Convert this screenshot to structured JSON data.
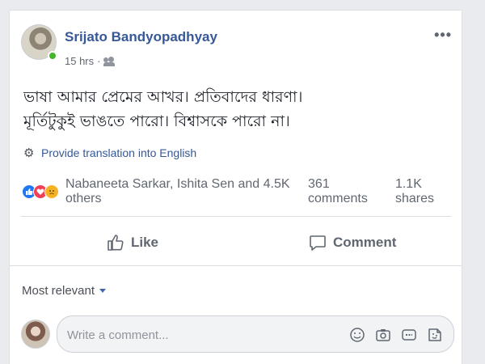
{
  "post": {
    "author": "Srijato Bandyopadhyay",
    "time": "15 hrs",
    "privacy_icon": "friends-icon",
    "text_line1": "ভাষা আমার প্রেমের আখর। প্রতিবাদের ধারণা।",
    "text_line2": "মূর্তিটুকুই ভাঙতে পারো। বিশ্বাসকে পারো না।",
    "translate_label": "Provide translation into English"
  },
  "reactions": {
    "types": [
      "like",
      "love",
      "sad"
    ],
    "reactors": "Nabaneeta Sarkar, Ishita Sen and 4.5K others",
    "comments": "361 comments",
    "shares": "1.1K shares"
  },
  "actions": {
    "like_label": "Like",
    "comment_label": "Comment"
  },
  "comments": {
    "sort_label": "Most relevant",
    "input_placeholder": "Write a comment...",
    "tools": [
      "emoji-icon",
      "camera-icon",
      "gif-icon",
      "sticker-icon"
    ]
  },
  "colors": {
    "link": "#365899",
    "like": "#2078f4",
    "love": "#f33e58",
    "sad": "#f7b125"
  }
}
